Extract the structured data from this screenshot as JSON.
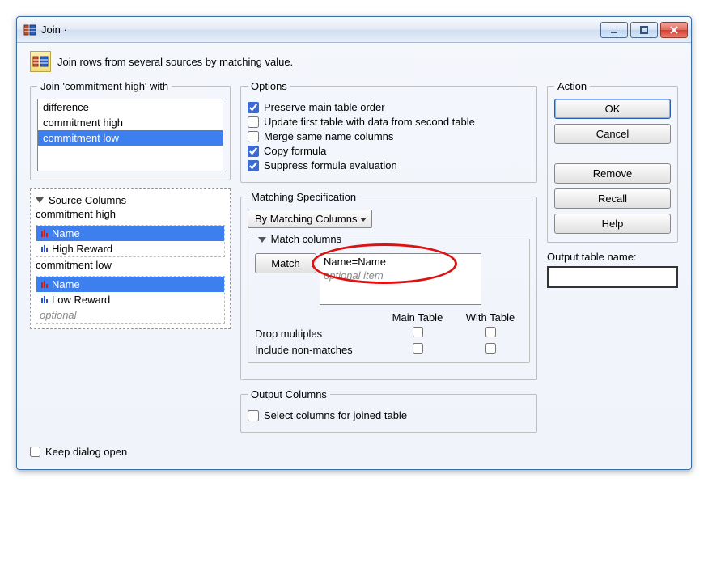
{
  "window_title": "Join ·",
  "description": "Join rows from several sources by matching value.",
  "join_with": {
    "legend": "Join 'commitment high' with",
    "items": [
      "difference",
      "commitment high",
      "commitment low"
    ],
    "selected_index": 2
  },
  "source_columns": {
    "legend": "Source Columns",
    "groups": [
      {
        "name": "commitment high",
        "columns": [
          {
            "label": "Name",
            "icon_color": "#c02020",
            "selected": true
          },
          {
            "label": "High Reward",
            "icon_color": "#3050c0",
            "selected": false
          }
        ]
      },
      {
        "name": "commitment low",
        "columns": [
          {
            "label": "Name",
            "icon_color": "#c02020",
            "selected": true
          },
          {
            "label": "Low Reward",
            "icon_color": "#3050c0",
            "selected": false
          }
        ],
        "optional_hint": "optional"
      }
    ]
  },
  "options": {
    "legend": "Options",
    "items": [
      {
        "label": "Preserve main table order",
        "checked": true
      },
      {
        "label": "Update first table with data from second table",
        "checked": false
      },
      {
        "label": "Merge same name columns",
        "checked": false
      },
      {
        "label": "Copy formula",
        "checked": true
      },
      {
        "label": "Suppress formula evaluation",
        "checked": true
      }
    ]
  },
  "matching": {
    "legend": "Matching Specification",
    "method_label": "By Matching Columns",
    "match_cols_legend": "Match columns",
    "match_button": "Match",
    "match_items": [
      "Name=Name"
    ],
    "match_optional": "optional item",
    "truth_headers": {
      "main": "Main Table",
      "with": "With Table"
    },
    "drop_label": "Drop multiples",
    "include_label": "Include non-matches",
    "truth": {
      "drop_main": false,
      "drop_with": false,
      "include_main": false,
      "include_with": false
    }
  },
  "output_cols": {
    "legend": "Output Columns",
    "select_label": "Select columns for joined table",
    "select_checked": false
  },
  "action": {
    "legend": "Action",
    "ok": "OK",
    "cancel": "Cancel",
    "remove": "Remove",
    "recall": "Recall",
    "help": "Help"
  },
  "output_table": {
    "label": "Output table name:",
    "value": ""
  },
  "keep_open": {
    "label": "Keep dialog open",
    "checked": false
  }
}
